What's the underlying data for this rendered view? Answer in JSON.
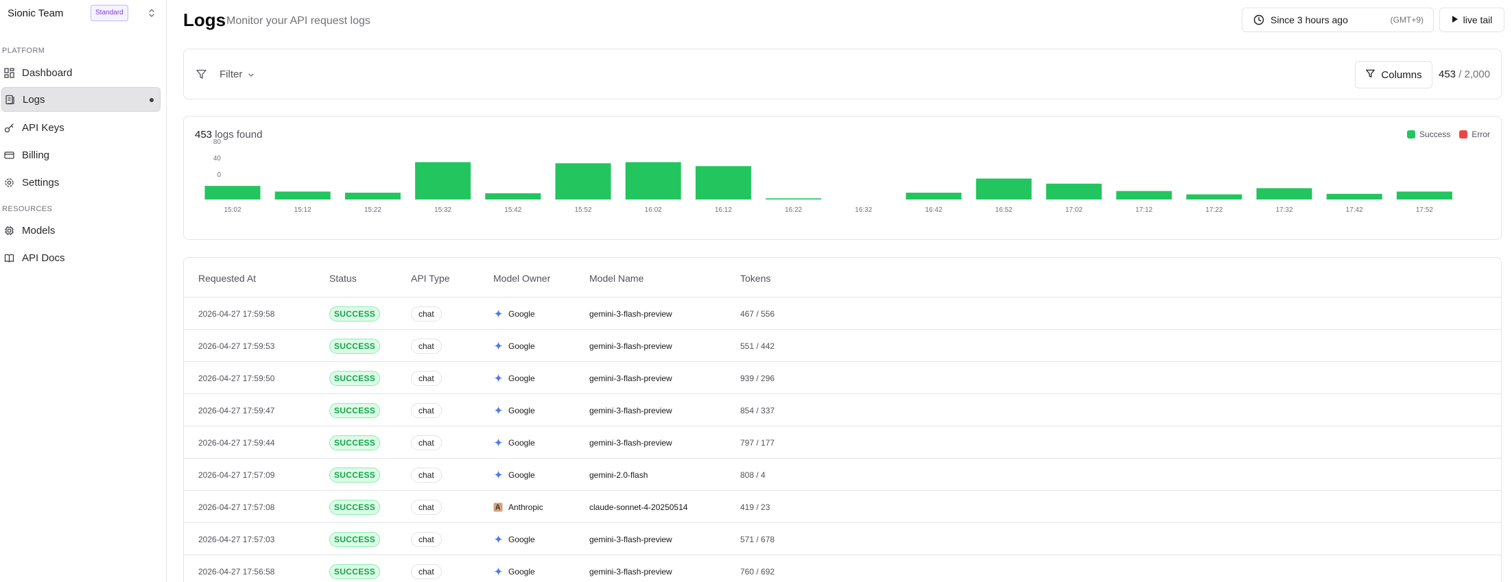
{
  "sidebar": {
    "team_name": "Sionic Team",
    "plan": "Standard",
    "platform_label": "PLATFORM",
    "resources_label": "RESOURCES",
    "items": [
      {
        "label": "Dashboard",
        "icon": "grid-icon"
      },
      {
        "label": "Logs",
        "icon": "logs-icon",
        "active": true
      },
      {
        "label": "API Keys",
        "icon": "key-icon"
      },
      {
        "label": "Billing",
        "icon": "card-icon"
      },
      {
        "label": "Settings",
        "icon": "gear-icon"
      },
      {
        "label": "Models",
        "icon": "cpu-icon"
      },
      {
        "label": "API Docs",
        "icon": "book-icon"
      }
    ]
  },
  "header": {
    "title": "Logs",
    "subtitle": "Monitor your API request logs",
    "time_range": "Since 3 hours ago",
    "timezone": "(GMT+9)",
    "live_tail": "live tail"
  },
  "filter": {
    "label": "Filter",
    "columns_label": "Columns",
    "count_shown": "453",
    "count_total": "/ 2,000"
  },
  "chart_data": {
    "type": "bar",
    "summary_count": "453",
    "summary_text": "logs found",
    "legend": [
      "Success",
      "Error"
    ],
    "colors": {
      "success": "#22c55e",
      "error": "#ef4444"
    },
    "y_ticks": [
      "80",
      "40",
      "0"
    ],
    "ylim": [
      0,
      80
    ],
    "categories": [
      "15:02",
      "15:12",
      "15:22",
      "15:32",
      "15:42",
      "15:52",
      "16:02",
      "16:12",
      "16:22",
      "16:32",
      "16:42",
      "16:52",
      "17:02",
      "17:12",
      "17:22",
      "17:32",
      "17:42",
      "17:52"
    ],
    "series": [
      {
        "name": "Success",
        "values": [
          24,
          14,
          12,
          66,
          11,
          64,
          66,
          59,
          2,
          0,
          12,
          37,
          28,
          15,
          9,
          20,
          10,
          14
        ]
      },
      {
        "name": "Error",
        "values": [
          0,
          0,
          0,
          0,
          0,
          0,
          0,
          0,
          0,
          0,
          0,
          0,
          0,
          0,
          0,
          0,
          0,
          0
        ]
      }
    ]
  },
  "table": {
    "headers": [
      "Requested At",
      "Status",
      "API Type",
      "Model Owner",
      "Model Name",
      "Tokens"
    ],
    "rows": [
      {
        "time": "2026-04-27 17:59:58",
        "status": "SUCCESS",
        "type": "chat",
        "owner": "Google",
        "model": "gemini-3-flash-preview",
        "tokens": "467 / 556"
      },
      {
        "time": "2026-04-27 17:59:53",
        "status": "SUCCESS",
        "type": "chat",
        "owner": "Google",
        "model": "gemini-3-flash-preview",
        "tokens": "551 / 442"
      },
      {
        "time": "2026-04-27 17:59:50",
        "status": "SUCCESS",
        "type": "chat",
        "owner": "Google",
        "model": "gemini-3-flash-preview",
        "tokens": "939 / 296"
      },
      {
        "time": "2026-04-27 17:59:47",
        "status": "SUCCESS",
        "type": "chat",
        "owner": "Google",
        "model": "gemini-3-flash-preview",
        "tokens": "854 / 337"
      },
      {
        "time": "2026-04-27 17:59:44",
        "status": "SUCCESS",
        "type": "chat",
        "owner": "Google",
        "model": "gemini-3-flash-preview",
        "tokens": "797 / 177"
      },
      {
        "time": "2026-04-27 17:57:09",
        "status": "SUCCESS",
        "type": "chat",
        "owner": "Google",
        "model": "gemini-2.0-flash",
        "tokens": "808 / 4"
      },
      {
        "time": "2026-04-27 17:57:08",
        "status": "SUCCESS",
        "type": "chat",
        "owner": "Anthropic",
        "model": "claude-sonnet-4-20250514",
        "tokens": "419 / 23"
      },
      {
        "time": "2026-04-27 17:57:03",
        "status": "SUCCESS",
        "type": "chat",
        "owner": "Google",
        "model": "gemini-3-flash-preview",
        "tokens": "571 / 678"
      },
      {
        "time": "2026-04-27 17:56:58",
        "status": "SUCCESS",
        "type": "chat",
        "owner": "Google",
        "model": "gemini-3-flash-preview",
        "tokens": "760 / 692"
      }
    ]
  }
}
